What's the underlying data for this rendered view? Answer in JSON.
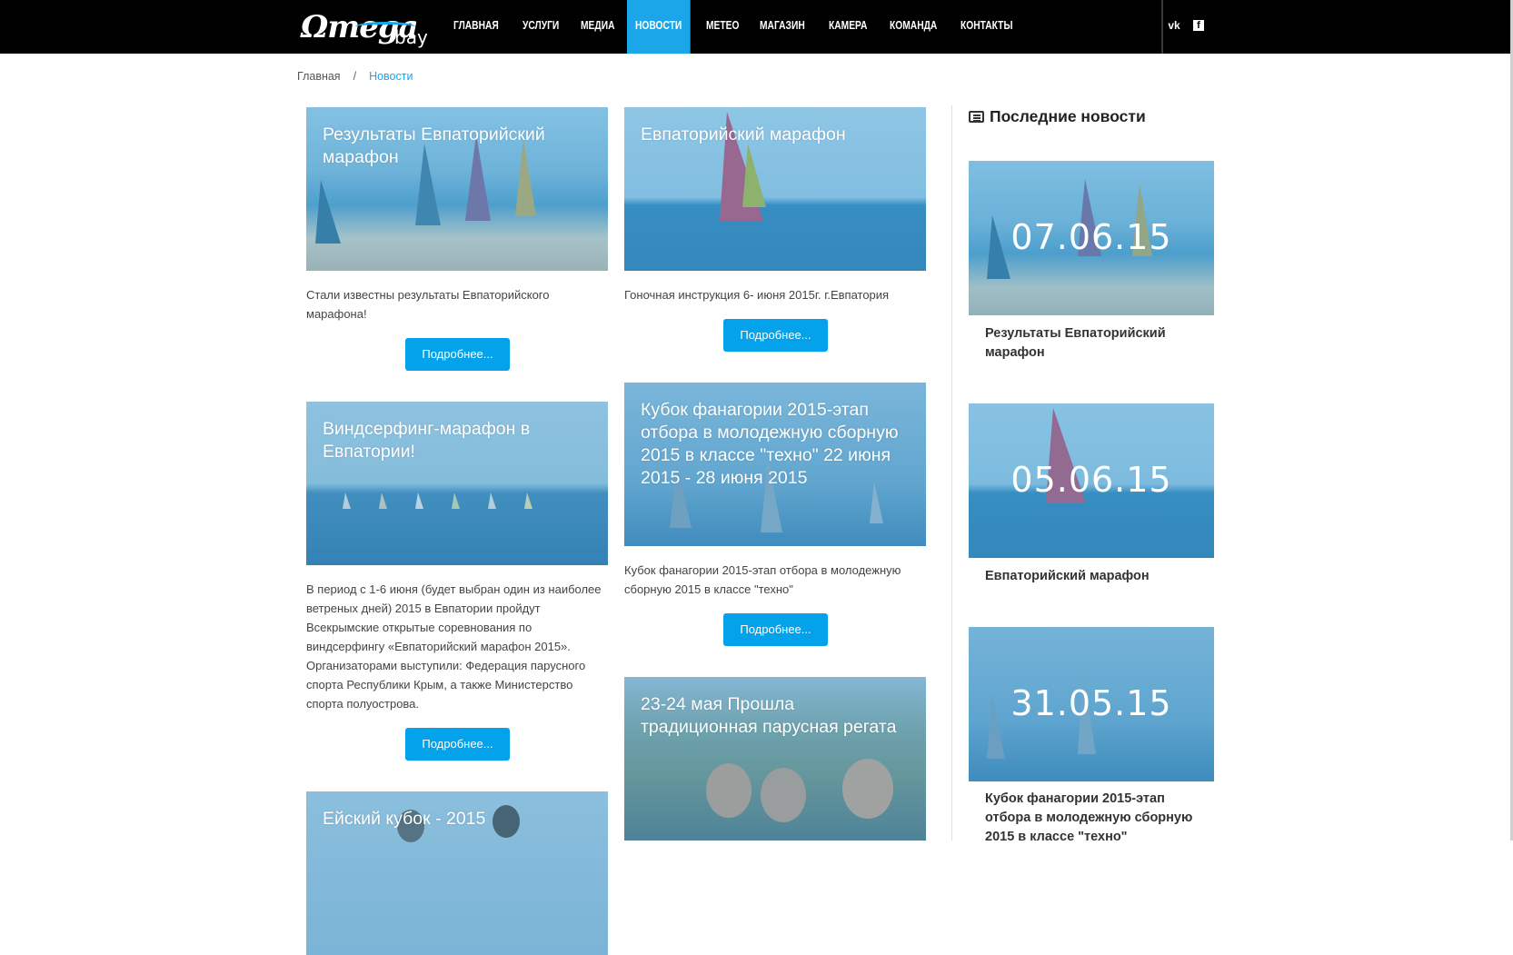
{
  "colors": {
    "accent": "#04a2ea",
    "topbar": "#000000"
  },
  "header": {
    "logo_main": "Ωmega",
    "logo_sub": "bay",
    "nav": [
      "ГЛАВНАЯ",
      "УСЛУГИ",
      "МЕДИА",
      "НОВОСТИ",
      "METEO",
      "МАГАЗИН",
      "КАМЕРА",
      "КОМАНДА",
      "КОНТАКТЫ"
    ],
    "active_nav": "НОВОСТИ",
    "social": {
      "vk": "vk",
      "facebook": "f"
    }
  },
  "breadcrumb": {
    "home": "Главная",
    "separator": "/",
    "current": "Новости"
  },
  "news": [
    {
      "title": "Результаты Евпаторийский марафон",
      "text": "Стали известны результаты Евпаторийского марафона!",
      "button": "Подробнее..."
    },
    {
      "title": "Евпаторийский марафон",
      "text": "Гоночная инструкция 6- июня 2015г. г.Евпатория",
      "button": "Подробнее..."
    },
    {
      "title": "Виндсерфинг-марафон в Евпатории!",
      "text": "В период с 1-6 июня (будет выбран один из наиболее ветреных дней) 2015 в Евпатории пройдут Всекрымские открытые соревнования по виндсерфингу «Евпаторийский марафон 2015». Организаторами выступили: Федерация парусного спорта Республики Крым, а также Министерство спорта полуострова.",
      "button": "Подробнее..."
    },
    {
      "title": "Кубок фанагории 2015-этап отбора в молодежную сборную 2015 в классе \"техно\" 22 июня 2015 - 28 июня 2015",
      "text": "Кубок фанагории 2015-этап отбора в молодежную сборную 2015 в классе \"техно\"",
      "button": "Подробнее..."
    },
    {
      "title": "23-24 мая Прошла традиционная парусная регата"
    },
    {
      "title": "Ейский кубок - 2015"
    }
  ],
  "sidebar": {
    "heading": "Последние новости",
    "items": [
      {
        "date": "07.06.15",
        "title": "Результаты Евпаторийский марафон"
      },
      {
        "date": "05.06.15",
        "title": "Евпаторийский марафон"
      },
      {
        "date": "31.05.15",
        "title": "Кубок фанагории 2015-этап отбора в молодежную сборную 2015 в классе \"техно\""
      }
    ]
  }
}
